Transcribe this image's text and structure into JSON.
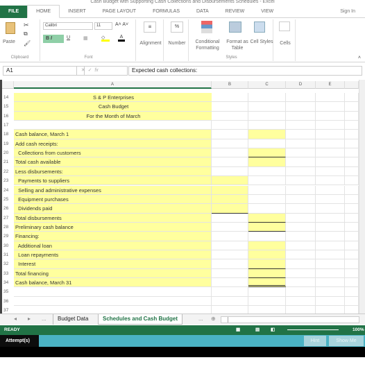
{
  "window": {
    "title": "Cash Budget with Supporting Cash Collections and Disbursements Schedules - Excel"
  },
  "ribbon_tabs": [
    "FILE",
    "HOME",
    "INSERT",
    "PAGE LAYOUT",
    "FORMULAS",
    "DATA",
    "REVIEW",
    "VIEW"
  ],
  "sign_in": "Sign In",
  "ribbon": {
    "paste": "Paste",
    "clipboard": "Clipboard",
    "font_name": "Calibri",
    "font_size": "11",
    "font": "Font",
    "alignment": "Alignment",
    "number": "Number",
    "conditional_formatting": "Conditional Formatting",
    "format_as_table": "Format as Table",
    "cell_styles": "Cell Styles",
    "styles": "Styles",
    "cells": "Cells",
    "bold": "B",
    "italic": "I",
    "underline": "U"
  },
  "formula_bar": {
    "name_box": "A1",
    "fx": "fx",
    "value": "Expected cash collections:"
  },
  "columns": [
    "A",
    "B",
    "C",
    "D",
    "E"
  ],
  "rows": [
    {
      "n": "14",
      "a": "S & P Enterprises",
      "center": true
    },
    {
      "n": "15",
      "a": "Cash Budget",
      "center": true
    },
    {
      "n": "16",
      "a": "For the Month of March",
      "center": true
    },
    {
      "n": "17",
      "a": ""
    },
    {
      "n": "18",
      "a": "Cash balance, March 1",
      "c": "y"
    },
    {
      "n": "19",
      "a": "Add cash receipts:"
    },
    {
      "n": "20",
      "a": "  Collections from customers",
      "c": "yb"
    },
    {
      "n": "21",
      "a": "Total cash available",
      "c": "y"
    },
    {
      "n": "22",
      "a": "Less disbursements:"
    },
    {
      "n": "23",
      "a": "  Payments to suppliers",
      "b": "y"
    },
    {
      "n": "24",
      "a": "  Selling and administrative expenses",
      "b": "y"
    },
    {
      "n": "25",
      "a": "  Equipment purchases",
      "b": "y"
    },
    {
      "n": "26",
      "a": "  Dividends paid",
      "b": "yb"
    },
    {
      "n": "27",
      "a": "Total disbursements",
      "c": "yb"
    },
    {
      "n": "28",
      "a": "Preliminary cash balance",
      "c": "yb"
    },
    {
      "n": "29",
      "a": "Financing:"
    },
    {
      "n": "30",
      "a": "  Additional loan",
      "c": "y"
    },
    {
      "n": "31",
      "a": "  Loan repayments",
      "c": "y"
    },
    {
      "n": "32",
      "a": "  Interest",
      "c": "yb"
    },
    {
      "n": "33",
      "a": "Total financing",
      "c": "yb"
    },
    {
      "n": "34",
      "a": "Cash balance, March 31",
      "c": "yd"
    },
    {
      "n": "35",
      "a": ""
    },
    {
      "n": "36",
      "a": ""
    },
    {
      "n": "37",
      "a": ""
    }
  ],
  "sheet_tabs": {
    "ellipsis": "...",
    "tabs": [
      "Budget Data",
      "Schedules and Cash Budget"
    ],
    "active": "Schedules and Cash Budget"
  },
  "status": {
    "ready": "READY",
    "zoom": "100%"
  },
  "attempt": {
    "label": "Attempt(s)",
    "hint": "Hint",
    "show_me": "Show Me"
  },
  "colors": {
    "excel_green": "#217346",
    "input_yellow": "#ffff9e",
    "attempt_bar": "#4ab3c4"
  }
}
